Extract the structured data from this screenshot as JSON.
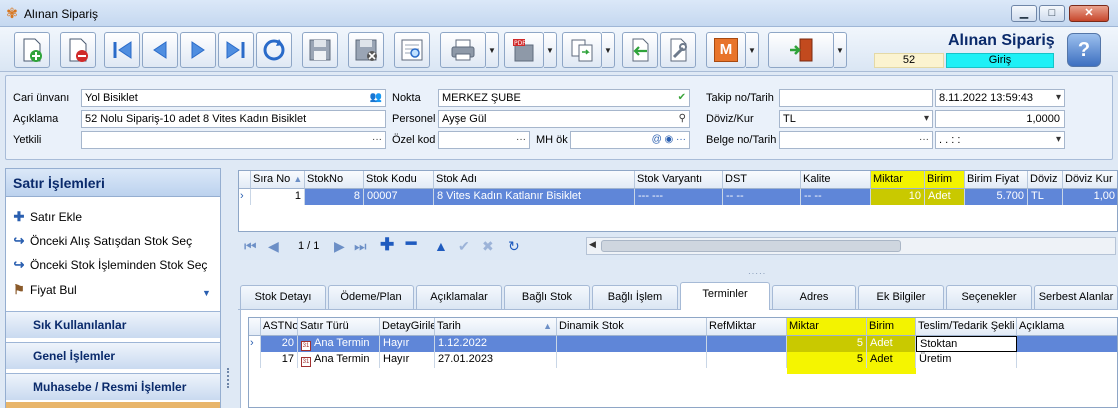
{
  "window": {
    "title": "Alınan Sipariş",
    "min": "▁",
    "max": "□",
    "close": "✕"
  },
  "header": {
    "form_title": "Alınan Sipariş",
    "doc_number": "52",
    "mode": "Giriş"
  },
  "toolbar": {
    "m_label": "M"
  },
  "form": {
    "cari_label": "Cari ünvanı",
    "cari_value": "Yol Bisiklet",
    "aciklama_label": "Açıklama",
    "aciklama_value": "52 Nolu Sipariş-10 adet 8 Vites Kadın Bisiklet",
    "yetkili_label": "Yetkili",
    "yetkili_value": "",
    "nokta_label": "Nokta",
    "nokta_value": "MERKEZ ŞUBE",
    "personel_label": "Personel",
    "personel_value": "Ayşe Gül",
    "ozelkod_label": "Özel kod",
    "ozelkod_value": "",
    "mhok_label": "MH ök",
    "mhok_value": "",
    "takip_label": "Takip no/Tarih",
    "takip_value": "",
    "takip_date": "8.11.2022 13:59:43",
    "doviz_label": "Döviz/Kur",
    "doviz_value": "TL",
    "kur_value": "1,0000",
    "belge_label": "Belge no/Tarih",
    "belge_value": "",
    "belge_date": ". .     :  :"
  },
  "left_panel": {
    "title": "Satır İşlemleri",
    "items": [
      "Satır Ekle",
      "Önceki Alış Satışdan Stok Seç",
      "Önceki Stok İşleminden Stok Seç",
      "Fiyat Bul"
    ],
    "sections": [
      "Sık Kullanılanlar",
      "Genel İşlemler",
      "Muhasebe / Resmi İşlemler"
    ]
  },
  "top_grid": {
    "headers": [
      "Sıra No",
      "StokNo",
      "Stok Kodu",
      "Stok Adı",
      "Stok Varyantı",
      "DST",
      "Kalite",
      "Miktar",
      "Birim",
      "Birim Fiyat",
      "Döviz",
      "Döviz Kur"
    ],
    "row": [
      "1",
      "8",
      "00007",
      "8 Vites Kadın Katlanır Bisiklet",
      "--- ---",
      "-- --",
      "-- --",
      "10",
      "Adet",
      "5.700",
      "TL",
      "1,00"
    ],
    "page": "1 / 1"
  },
  "tabs": [
    "Stok Detayı",
    "Ödeme/Plan",
    "Açıklamalar",
    "Bağlı Stok",
    "Bağlı İşlem",
    "Terminler",
    "Adres",
    "Ek Bilgiler",
    "Seçenekler",
    "Serbest Alanlar"
  ],
  "bottom_grid": {
    "headers": [
      "ASTNo",
      "Satır Türü",
      "DetayGirile",
      "Tarih",
      "Dinamik Stok",
      "RefMiktar",
      "Miktar",
      "Birim",
      "Teslim/Tedarik Şekli",
      "Açıklama"
    ],
    "rows": [
      [
        "20",
        "Ana Termin",
        "Hayır",
        "1.12.2022",
        "",
        "",
        "5",
        "Adet",
        "Stoktan",
        ""
      ],
      [
        "17",
        "Ana Termin",
        "Hayır",
        "27.01.2023",
        "",
        "",
        "5",
        "Adet",
        "Üretim",
        ""
      ]
    ]
  },
  "colors": {
    "accent": "#0a2a6b",
    "selection": "#5f86d8",
    "highlight": "#f3f300",
    "mode": "#1ef0f6"
  }
}
